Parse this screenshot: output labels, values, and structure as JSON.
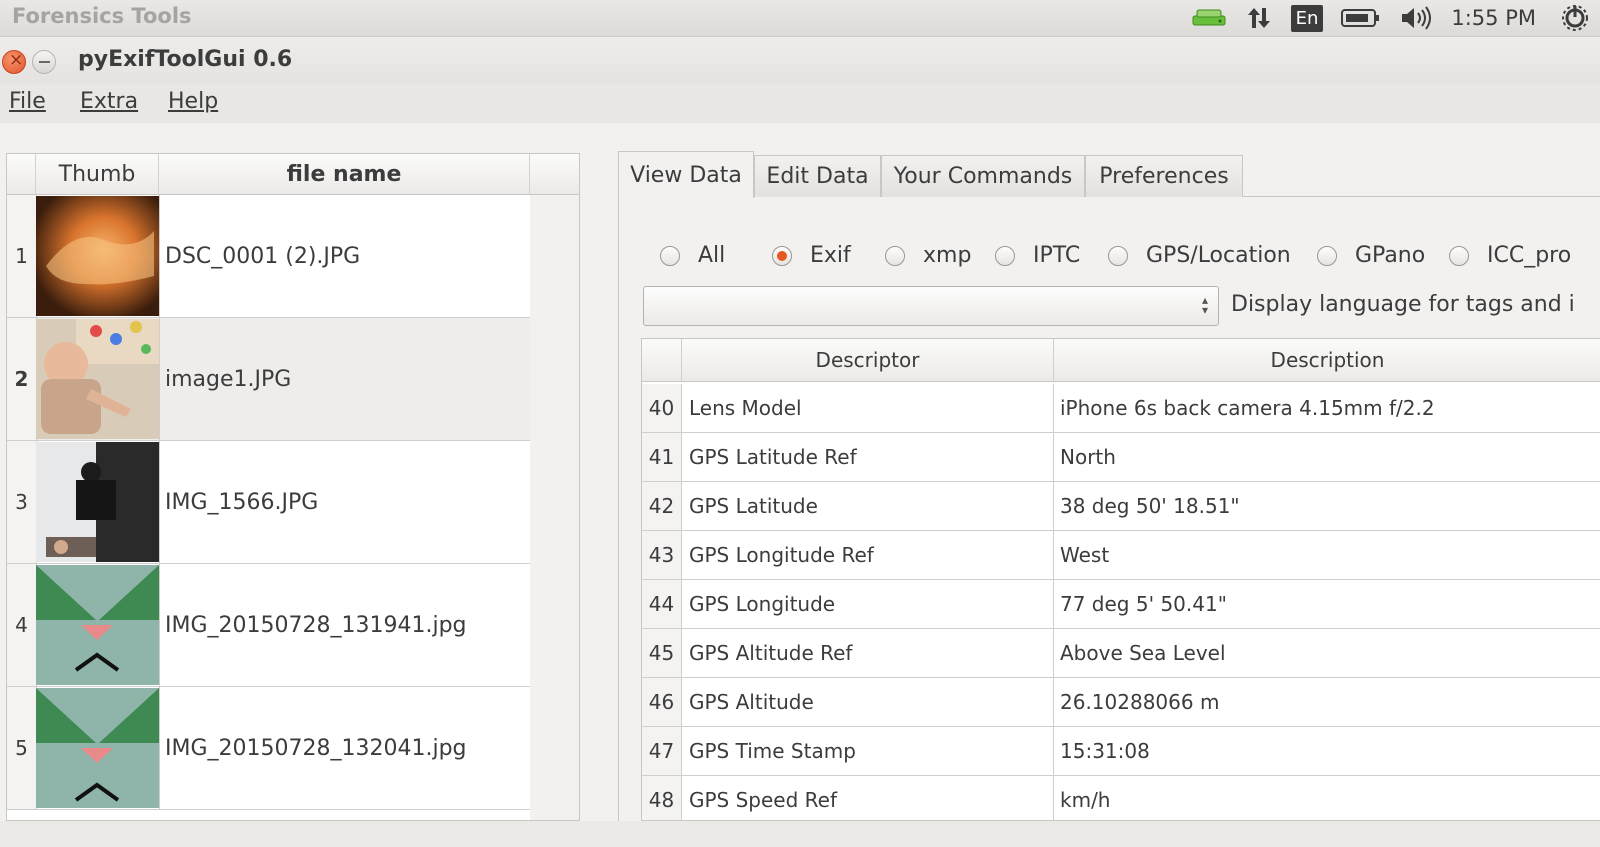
{
  "system_panel": {
    "title": "Forensics Tools",
    "keyboard_layout": "En",
    "clock": "1:55 PM"
  },
  "window": {
    "title": "pyExifToolGui 0.6"
  },
  "menu": {
    "file": "File",
    "extra": "Extra",
    "help": "Help"
  },
  "file_table": {
    "headers": {
      "thumb": "Thumb",
      "file_name": "file name"
    },
    "rows": [
      {
        "num": "1",
        "file_name": "DSC_0001 (2).JPG"
      },
      {
        "num": "2",
        "file_name": "image1.JPG"
      },
      {
        "num": "3",
        "file_name": "IMG_1566.JPG"
      },
      {
        "num": "4",
        "file_name": "IMG_20150728_131941.jpg"
      },
      {
        "num": "5",
        "file_name": "IMG_20150728_132041.jpg"
      }
    ],
    "selected_row": "2"
  },
  "tabs": {
    "view_data": "View Data",
    "edit_data": "Edit Data",
    "your_commands": "Your Commands",
    "preferences": "Preferences",
    "active": "View Data"
  },
  "filters": {
    "all": "All",
    "exif": "Exif",
    "xmp": "xmp",
    "iptc": "IPTC",
    "gps": "GPS/Location",
    "gpano": "GPano",
    "icc": "ICC_pro",
    "selected": "Exif"
  },
  "language": {
    "combo_value": "",
    "label": "Display language for tags and i"
  },
  "data_table": {
    "headers": {
      "descriptor": "Descriptor",
      "description": "Description"
    },
    "rows": [
      {
        "num": "40",
        "descriptor": "Lens Model",
        "description": "iPhone 6s back camera 4.15mm f/2.2"
      },
      {
        "num": "41",
        "descriptor": "GPS Latitude Ref",
        "description": "North"
      },
      {
        "num": "42",
        "descriptor": "GPS Latitude",
        "description": "38 deg 50' 18.51\""
      },
      {
        "num": "43",
        "descriptor": "GPS Longitude Ref",
        "description": "West"
      },
      {
        "num": "44",
        "descriptor": "GPS Longitude",
        "description": "77 deg 5' 50.41\""
      },
      {
        "num": "45",
        "descriptor": "GPS Altitude Ref",
        "description": "Above Sea Level"
      },
      {
        "num": "46",
        "descriptor": "GPS Altitude",
        "description": "26.10288066 m"
      },
      {
        "num": "47",
        "descriptor": "GPS Time Stamp",
        "description": "15:31:08"
      },
      {
        "num": "48",
        "descriptor": "GPS Speed Ref",
        "description": "km/h"
      }
    ]
  },
  "colors": {
    "accent_radio": "#e9571f",
    "close_button": "#e2572c",
    "network_icon": "#6abf3a"
  }
}
